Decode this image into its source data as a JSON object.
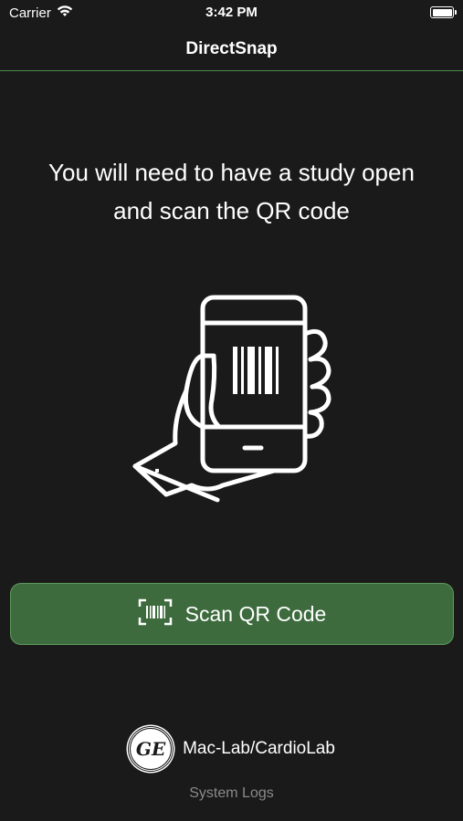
{
  "status_bar": {
    "carrier": "Carrier",
    "time": "3:42 PM",
    "wifi_icon": "wifi-icon",
    "battery_icon": "battery-icon",
    "battery_level": 1.0
  },
  "nav": {
    "title": "DirectSnap"
  },
  "main": {
    "instruction_line1": "You will need to have a study open",
    "instruction_line2": "and scan the QR code",
    "illustration_icon": "hand-holding-phone-barcode-icon"
  },
  "scan_button": {
    "label": "Scan QR Code",
    "icon": "barcode-scan-icon"
  },
  "brand": {
    "logo_text": "GE",
    "label": "Mac-Lab/CardioLab"
  },
  "footer": {
    "system_logs_label": "System Logs"
  },
  "colors": {
    "background": "#1a1a1a",
    "accent_green": "#3d6b3d",
    "accent_border": "#5f9a5f",
    "divider": "#4a8a4a",
    "muted_text": "#8a8a8a"
  }
}
